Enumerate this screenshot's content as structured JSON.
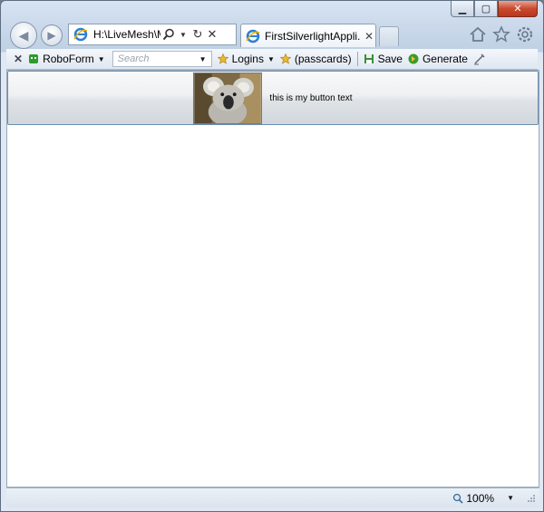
{
  "window": {
    "caption": {
      "minimize_icon": "minimize-icon",
      "maximize_icon": "maximize-icon",
      "close_icon": "close-icon"
    }
  },
  "nav": {
    "back_icon": "back-arrow-icon",
    "forward_icon": "forward-arrow-icon",
    "address_value": "H:\\LiveMesh\\M",
    "tab_title": "FirstSilverlightAppli...",
    "tab_close": "✕"
  },
  "toolbar": {
    "close": "✕",
    "roboform_label": "RoboForm",
    "search_placeholder": "Search",
    "logins_label": "Logins",
    "passcards_label": "(passcards)",
    "save_label": "Save",
    "generate_label": "Generate"
  },
  "content": {
    "button_text": "this is my button text",
    "image_subject": "koala"
  },
  "statusbar": {
    "zoom": "100%"
  },
  "colors": {
    "frame": "#c9d8ea",
    "content_bg": "#ffffff",
    "button_border": "#6b8eb1"
  }
}
